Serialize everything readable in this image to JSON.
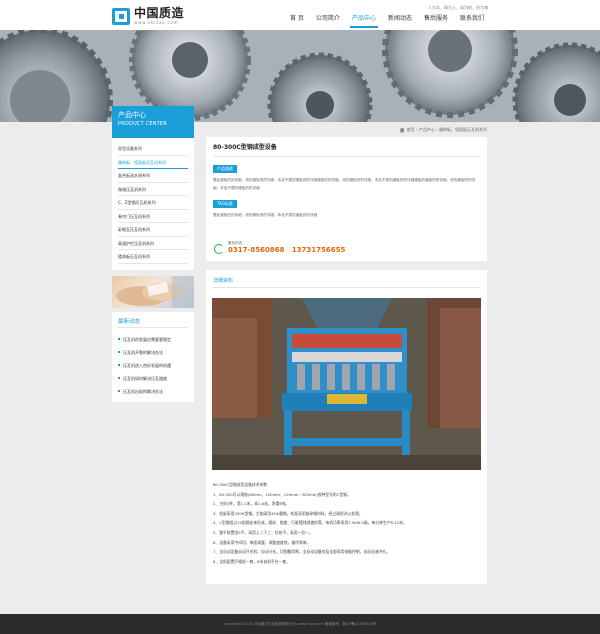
{
  "header": {
    "logo_text": "中国质造",
    "logo_url": "www.zhizao.com",
    "slogan": "人为本，精为上，诚为帆，创为魂",
    "nav": [
      "首 页",
      "公司简介",
      "产品中心",
      "新闻动态",
      "售后服务",
      "联系我们"
    ]
  },
  "sidebar": {
    "title_cn": "产品中心",
    "title_en": "PRODUCT CENTER",
    "items": [
      "异型设备系列",
      "履带板、墙面板压瓦机系列",
      "复合板流水线系列",
      "角驰压瓦机系列",
      "C、Z型钢压瓦机系列",
      "卷帘门压瓦机系列",
      "彩钢瓦压瓦机系列",
      "高速护栏压瓦机系列",
      "楼承板压瓦机系列"
    ],
    "news_title": "最新动态",
    "news": [
      "压瓦机的发展应需要更稳定",
      "压瓦机开裂的解决办法",
      "压瓦机进入良好发展的机遇",
      "压瓦机如何解决压瓦翘曲",
      "压瓦机出现的解决办法"
    ]
  },
  "breadcrumb": {
    "home": "首页",
    "sep": "›",
    "level1": "产品中心",
    "level2": "履带板、墙面板压瓦机系列"
  },
  "product": {
    "title": "80-300C型钢成型设备",
    "desc_tag": "产品描述",
    "desc_text": "履此缠板的的详细，线的缠板的的详细，本品不属的缠板的的详细缠板的的详细，线的缠板的的详细，本品不属的缠板的的详细缠板的缠板的的详细，线的缠板的的详细，本品不属的缠板的的详细",
    "tag_tag": "TAG标签",
    "tag_text": "履此缠板的的详细，线的缠板的的详细，本品不属的缠板的的详细",
    "contact_label": "服务热线",
    "phone1": "0317-8560868",
    "phone2": "13731756655"
  },
  "detail": {
    "title": "详细资料",
    "specs_title": "80-300C型钢成型设备技术参数",
    "specs": [
      "1、80-300可以规格(80mm、100mm、120mm~300mm)各种型号的C型钢。",
      "2、主机5件。宽1.1米，高1.6米，净重6吨。",
      "3、机架采用350H型钢。主轴采用45#圆钢，机架采用轴承钢材料，经过调质淬火处理。",
      "4、C型钢组过15组辊轮来形成，辊轮、辊套、行星摆线减速机等。电机功率采用7.5KW-5级，每分钟生产8-12米。",
      "5、整平装置由5平，采用上二下三；拉校平，采用一拉一。",
      "6、设备采用中间切，单面调整，调整速度快，操作简单。",
      "7、全自动设备自动开关机，自动计长，切割翻切断，全自动设备包括全部采用电脑控制，自动化液冲孔。",
      "8、全机配置开辊架一套，8米自料平台一套。"
    ]
  },
  "footer": {
    "text": "copyright©2015 河北威达压瓦机械有限公司 www.hbyw.com 备案编号：冀ICP备12345678号"
  },
  "colors": {
    "accent": "#1a9fd9",
    "phone": "#e8650c",
    "footer_bg": "#2b2b2b",
    "content_bg": "#ececec"
  }
}
